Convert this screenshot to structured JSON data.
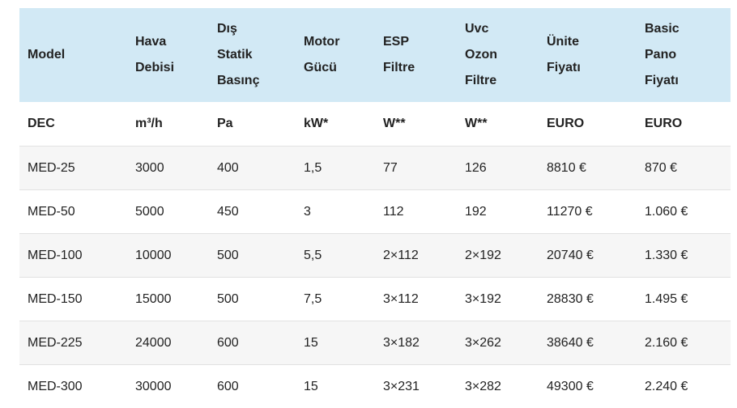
{
  "table": {
    "headers": [
      [
        "Model"
      ],
      [
        "Hava",
        "Debisi"
      ],
      [
        "Dış",
        "Statik",
        "Basınç"
      ],
      [
        "Motor",
        "Gücü"
      ],
      [
        "ESP",
        "Filtre"
      ],
      [
        "Uvc",
        "Ozon",
        "Filtre"
      ],
      [
        "Ünite",
        "Fiyatı"
      ],
      [
        "Basic",
        "Pano",
        "Fiyatı"
      ]
    ],
    "units": [
      "DEC",
      "m³/h",
      "Pa",
      "kW*",
      "W**",
      "W**",
      "EURO",
      "EURO"
    ],
    "rows": [
      [
        "MED-25",
        "3000",
        "400",
        "1,5",
        "77",
        "126",
        "8810 €",
        "870 €"
      ],
      [
        "MED-50",
        "5000",
        "450",
        "3",
        "112",
        "192",
        "11270 €",
        "1.060 €"
      ],
      [
        "MED-100",
        "10000",
        "500",
        "5,5",
        "2×112",
        "2×192",
        "20740 €",
        "1.330 €"
      ],
      [
        "MED-150",
        "15000",
        "500",
        "7,5",
        "3×112",
        "3×192",
        "28830 €",
        "1.495 €"
      ],
      [
        "MED-225",
        "24000",
        "600",
        "15",
        "3×182",
        "3×262",
        "38640 €",
        "2.160 €"
      ],
      [
        "MED-300",
        "30000",
        "600",
        "15",
        "3×231",
        "3×282",
        "49300 €",
        "2.240 €"
      ]
    ]
  },
  "colors": {
    "header_bg": "#d2e9f5",
    "stripe_bg": "#f6f6f6",
    "row_border": "#e2e2e2",
    "text": "#222222"
  }
}
